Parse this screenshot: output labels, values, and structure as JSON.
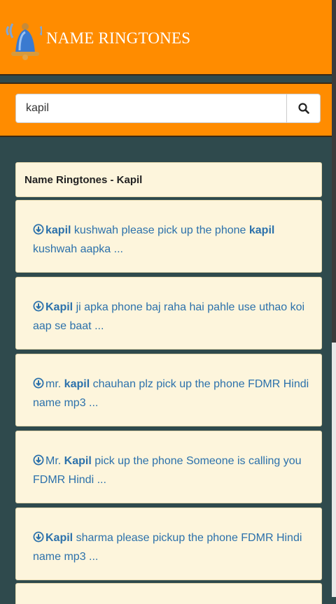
{
  "header": {
    "title": "NAME RINGTONES",
    "logo_icon": "bell-icon",
    "background": "#ff8c00"
  },
  "search": {
    "value": "kapil",
    "button_icon": "search-icon"
  },
  "panel": {
    "heading": "Name Ringtones - Kapil"
  },
  "results": [
    {
      "pre": "",
      "keyword": "kapil",
      "mid": " kushwah please pick up the phone ",
      "keyword2": "kapil",
      "post": " kushwah aapka ..."
    },
    {
      "pre": "",
      "keyword": "Kapil",
      "mid": " ji apka phone baj raha hai pahle use uthao koi aap se baat ...",
      "keyword2": "",
      "post": ""
    },
    {
      "pre": "mr. ",
      "keyword": "kapil",
      "mid": " chauhan plz pick up the phone FDMR Hindi name mp3 ...",
      "keyword2": "",
      "post": ""
    },
    {
      "pre": "Mr. ",
      "keyword": "Kapil",
      "mid": " pick up the phone Someone is calling you FDMR Hindi ...",
      "keyword2": "",
      "post": ""
    },
    {
      "pre": "",
      "keyword": "Kapil",
      "mid": " sharma please pickup the phone FDMR Hindi name mp3 ...",
      "keyword2": "",
      "post": ""
    }
  ],
  "colors": {
    "link": "#2c71ab",
    "card": "#fdf5dc",
    "page_bg": "#2f4a4d"
  }
}
